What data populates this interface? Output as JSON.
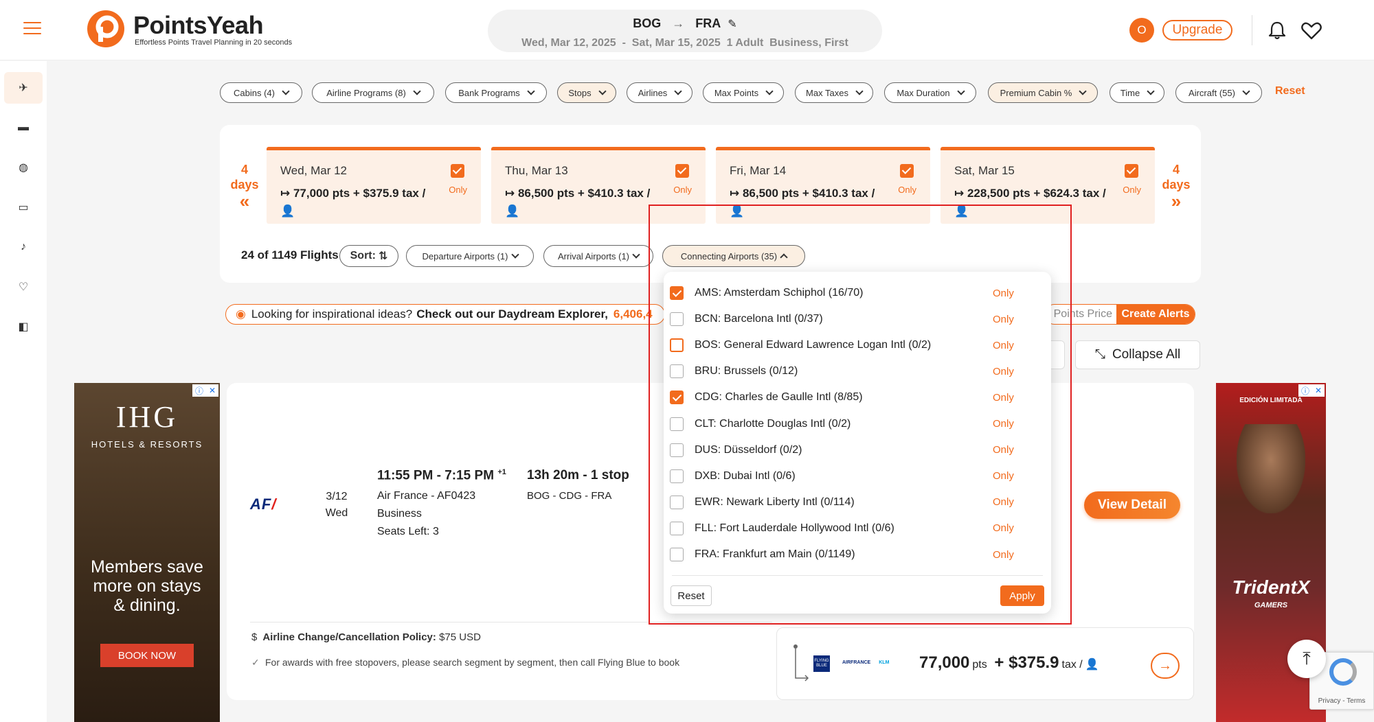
{
  "header": {
    "brand": "PointsYeah",
    "tagline": "Effortless Points Travel Planning in 20 seconds",
    "origin": "BOG",
    "destination": "FRA",
    "trip_line": "Wed, Mar 12, 2025  -  Sat, Mar 15, 2025  1 Adult  Business, First",
    "avatar_initial": "O",
    "upgrade_label": "Upgrade"
  },
  "sidebar": {
    "items": [
      {
        "name": "flights",
        "glyph": "✈"
      },
      {
        "name": "hotels",
        "glyph": "▬"
      },
      {
        "name": "explore",
        "glyph": "◍"
      },
      {
        "name": "cards",
        "glyph": "▭"
      },
      {
        "name": "alerts",
        "glyph": "♪"
      },
      {
        "name": "favorites",
        "glyph": "♡"
      },
      {
        "name": "wallet",
        "glyph": "◧"
      }
    ]
  },
  "filters": {
    "chips": [
      "Cabins (4)",
      "Airline Programs (8)",
      "Bank Programs",
      "Stops",
      "Airlines",
      "Max Points",
      "Max Taxes",
      "Max Duration",
      "Premium Cabin %",
      "Time",
      "Aircraft (55)"
    ],
    "reset_label": "Reset"
  },
  "dates": {
    "prev_label_num": "4",
    "prev_label_unit": "days",
    "next_label_num": "4",
    "next_label_unit": "days",
    "cards": [
      {
        "label": "Wed, Mar 12",
        "price": "77,000 pts + $375.9 tax /",
        "only": "Only"
      },
      {
        "label": "Thu, Mar 13",
        "price": "86,500 pts + $410.3 tax /",
        "only": "Only"
      },
      {
        "label": "Fri, Mar 14",
        "price": "86,500 pts + $410.3 tax /",
        "only": "Only"
      },
      {
        "label": "Sat, Mar 15",
        "price": "228,500 pts + $624.3 tax /",
        "only": "Only"
      }
    ]
  },
  "results": {
    "count": "24 of 1149 Flights",
    "sort_label": "Sort:",
    "departure_airports": "Departure Airports (1)",
    "arrival_airports": "Arrival Airports (1)",
    "connecting_airports": "Connecting Airports (35)"
  },
  "banner": {
    "lead": "Looking for inspirational ideas?",
    "cta": "Check out our Daydream Explorer,",
    "count": "6,406,4",
    "points_price": "Points Price",
    "create_alerts": "Create Alerts",
    "collapse_all": "Collapse All"
  },
  "ads": {
    "left": {
      "brand": "IHG",
      "sub": "HOTELS & RESORTS",
      "line1": "Members save",
      "line2": "more on stays",
      "line3": "& dining.",
      "cta": "BOOK NOW"
    },
    "right": {
      "edition": "EDICIÓN LIMITADA",
      "brand": "TridentX",
      "sub": "GAMERS"
    }
  },
  "flight": {
    "airline_logo": "AF",
    "date": "3/12",
    "weekday": "Wed",
    "time": "11:55 PM - 7:15 PM",
    "day_offset": "+1",
    "airline": "Air France - AF0423",
    "cabin": "Business",
    "seats": "Seats Left: 3",
    "duration": "13h 20m - 1 stop",
    "route": "BOG - CDG - FRA",
    "view_detail": "View Detail",
    "policy_label": "Airline Change/Cancellation Policy:",
    "policy_value": "$75 USD",
    "stopover_note": "For awards with free stopovers, please search segment by segment, then call Flying Blue to book",
    "program_logo": "FLYING BLUE",
    "partner_logo_a": "AIRFRANCE",
    "partner_logo_b": "KLM",
    "price_pts": "77,000",
    "pts_unit": "pts",
    "price_plus": "+",
    "price_tax": "$375.9",
    "tax_unit": "tax /"
  },
  "connecting_dropdown": {
    "only_label": "Only",
    "items": [
      {
        "label": "AMS: Amsterdam Schiphol (16/70)",
        "checked": true
      },
      {
        "label": "BCN: Barcelona Intl (0/37)",
        "checked": false
      },
      {
        "label": "BOS: General Edward Lawrence Logan Intl (0/2)",
        "checked": false
      },
      {
        "label": "BRU: Brussels (0/12)",
        "checked": false
      },
      {
        "label": "CDG: Charles de Gaulle Intl (8/85)",
        "checked": true
      },
      {
        "label": "CLT: Charlotte Douglas Intl (0/2)",
        "checked": false
      },
      {
        "label": "DUS: Düsseldorf (0/2)",
        "checked": false
      },
      {
        "label": "DXB: Dubai Intl (0/6)",
        "checked": false
      },
      {
        "label": "EWR: Newark Liberty Intl (0/114)",
        "checked": false
      },
      {
        "label": "FLL: Fort Lauderdale Hollywood Intl (0/6)",
        "checked": false
      },
      {
        "label": "FRA: Frankfurt am Main (0/1149)",
        "checked": false
      }
    ],
    "reset_label": "Reset",
    "apply_label": "Apply"
  },
  "recaptcha": {
    "text": "Privacy - Terms"
  },
  "colors": {
    "accent": "#f26b1d",
    "highlight_border": "#e02020"
  }
}
